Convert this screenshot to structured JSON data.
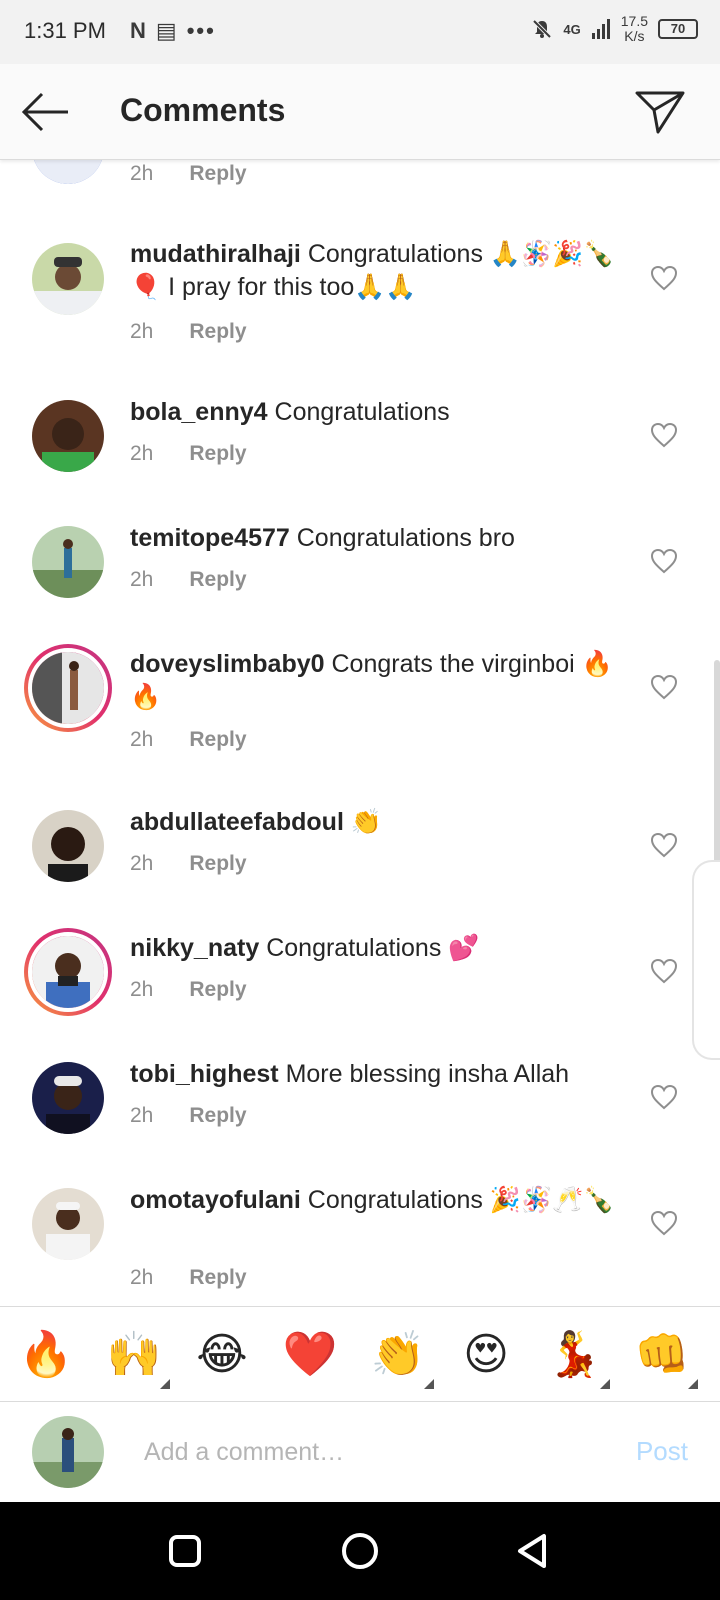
{
  "status_bar": {
    "time": "1:31 PM",
    "left_icons": [
      "N",
      "▤",
      "•••"
    ],
    "network": "4G",
    "speed_value": "17.5",
    "speed_unit": "K/s",
    "battery": "70"
  },
  "header": {
    "title": "Comments",
    "back_icon": "arrow-left-icon",
    "share_icon": "paper-plane-icon"
  },
  "comments": [
    {
      "username": "",
      "text": "",
      "time": "2h",
      "reply_label": "Reply",
      "has_story": false
    },
    {
      "username": "mudathiralhaji",
      "text": "Congratulations 🙏🪅🎉🍾🎈 I pray for this too🙏🙏",
      "time": "2h",
      "reply_label": "Reply",
      "has_story": false
    },
    {
      "username": "bola_enny4",
      "text": "Congratulations",
      "time": "2h",
      "reply_label": "Reply",
      "has_story": false
    },
    {
      "username": "temitope4577",
      "text": "Congratulations bro",
      "time": "2h",
      "reply_label": "Reply",
      "has_story": false
    },
    {
      "username": "doveyslimbaby0",
      "text": "Congrats the virginboi 🔥🔥",
      "time": "2h",
      "reply_label": "Reply",
      "has_story": true
    },
    {
      "username": "abdullateefabdoul",
      "text": "👏",
      "time": "2h",
      "reply_label": "Reply",
      "has_story": false
    },
    {
      "username": "nikky_naty",
      "text": "Congratulations 💕",
      "time": "2h",
      "reply_label": "Reply",
      "has_story": true
    },
    {
      "username": "tobi_highest",
      "text": "More blessing insha Allah",
      "time": "2h",
      "reply_label": "Reply",
      "has_story": false
    },
    {
      "username": "omotayofulani",
      "text": "Congratulations 🎉🪅🥂🍾",
      "time": "2h",
      "reply_label": "Reply",
      "has_story": false
    }
  ],
  "emoji_bar": [
    "🔥",
    "🙌",
    "😂",
    "❤️",
    "👏",
    "😍",
    "💃",
    "👊"
  ],
  "composer": {
    "placeholder": "Add a comment…",
    "post_label": "Post"
  },
  "nav": [
    "square-icon",
    "circle-icon",
    "triangle-back-icon"
  ],
  "colors": {
    "text": "#262626",
    "muted": "#8e8e8e",
    "post_disabled": "#b3dbff",
    "story_ring_start": "#f9a03c",
    "story_ring_end": "#c13584"
  }
}
